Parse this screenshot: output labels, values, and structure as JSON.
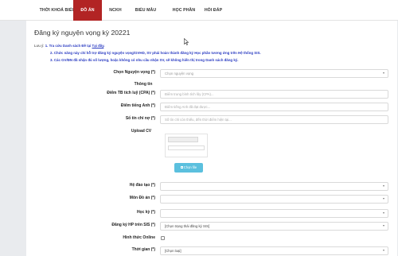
{
  "nav": {
    "items": [
      {
        "label": "THỜI KHOÁ BIỂU"
      },
      {
        "label": "ĐỒ ÁN"
      },
      {
        "label": "NCKH"
      },
      {
        "label": "BIỂU MẪU"
      },
      {
        "label": "HỌC PHẦN"
      },
      {
        "label": "HỎI ĐÁP"
      }
    ],
    "active_color": "#b22424"
  },
  "page": {
    "title": "Đăng ký nguyện vọng kỳ 20221"
  },
  "notes": {
    "prefix": "Lưu ý:",
    "n1_text": "1. Tra cứu Danh sách Đề tại ",
    "n1_link": "Tại đây",
    "n1_end": ".",
    "n2": "2. Chức năng này chỉ hỗ trợ đăng ký nguyện vọng/GVHD, SV phải hoàn thành đăng ký Học phần tương ứng trên Hệ thống SIS.",
    "n3": "3. Các GV/ĐN đã nhận đủ số lượng, hoặc không có nhu cầu nhận SV, sẽ không hiển thị trong Danh sách đăng ký.",
    "color": "#2b3cc2"
  },
  "form": {
    "chon_nguyen_vong_label": "Chọn Nguyện vọng (*)",
    "chon_nguyen_vong_placeholder": "Chọn nguyện vọng",
    "thong_tin_label": "Thông tin",
    "cpa_label": "Điểm TB tích luỹ (CPA) (*)",
    "cpa_placeholder": "Điểm trung bình tích lũy (CPA)...",
    "tieng_anh_label": "Điểm tiếng Anh (*)",
    "tieng_anh_placeholder": "Điểm tiếng Anh đã đạt được...",
    "tin_chi_no_label": "Số tín chỉ nợ (*)",
    "tin_chi_no_placeholder": "Số tín chỉ còn thiếu, đến thời điểm hiện tại...",
    "upload_cv_label": "Upload CV",
    "choose_file_label": "Chọn file",
    "he_dao_tao_label": "Hệ đào tạo (*)",
    "mon_do_an_label": "Môn Đồ án (*)",
    "hoc_ky_label": "Học kỳ (*)",
    "dang_ky_hp_label": "Đăng ký HP trên SIS (*)",
    "dang_ky_hp_value": "[Chọn trạng thái đăng ký SIS]",
    "hinh_thuc_online_label": "Hình thức Online",
    "thoi_gian_label": "Thời gian (*)",
    "thoi_gian_value": "[Chọn loại]"
  }
}
